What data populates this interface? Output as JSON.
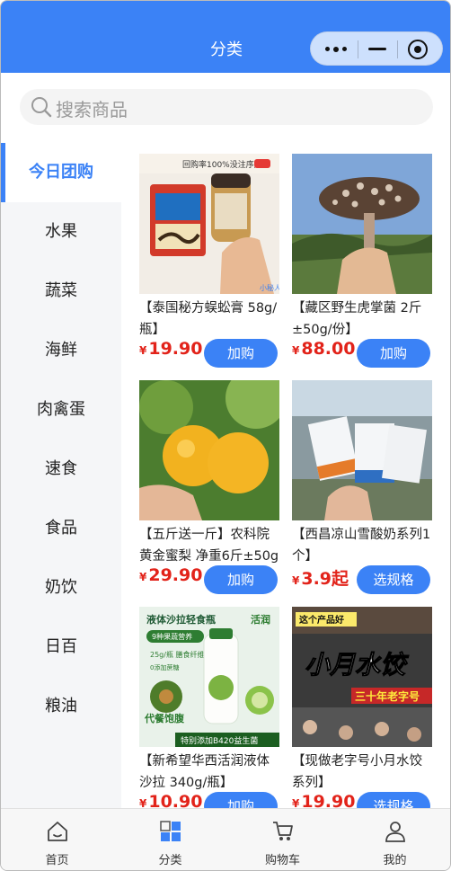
{
  "header": {
    "title": "分类"
  },
  "search": {
    "placeholder": "搜索商品"
  },
  "sidebar": {
    "items": [
      {
        "label": "今日团购",
        "active": true
      },
      {
        "label": "水果"
      },
      {
        "label": "蔬菜"
      },
      {
        "label": "海鲜"
      },
      {
        "label": "肉禽蛋"
      },
      {
        "label": "速食"
      },
      {
        "label": "食品"
      },
      {
        "label": "奶饮"
      },
      {
        "label": "日百"
      },
      {
        "label": "粮油"
      }
    ]
  },
  "products": [
    {
      "name": "【泰国秘方蜈蚣膏 58g/瓶】",
      "currency": "¥",
      "price": "19.90",
      "button": "加购",
      "image_text_top": "回购率100%没注序产",
      "image_text_bottom": "小秘人"
    },
    {
      "name": "【藏区野生虎掌菌 2斤±50g/份】",
      "currency": "¥",
      "price": "88.00",
      "button": "加购"
    },
    {
      "name": "【五斤送一斤】农科院黄金蜜梨 净重6斤±50g",
      "currency": "¥",
      "price": "29.90",
      "button": "加购"
    },
    {
      "name": "【西昌凉山雪酸奶系列1个】",
      "currency": "¥",
      "price": "3.9起",
      "button": "选规格"
    },
    {
      "name": "【新希望华西活润液体沙拉 340g/瓶】",
      "currency": "¥",
      "price": "10.90",
      "button": "加购",
      "image_text_top": "液体沙拉轻食瓶",
      "image_brand": "活润",
      "image_tag1": "9种果蔬营养",
      "image_tag2": "25g/瓶 膳食纤维",
      "image_tag3": "0添加蔗糖",
      "image_text_left": "代餐饱腹",
      "image_text_bottom": "特别添加B420益生菌"
    },
    {
      "name": "【现做老字号小月水饺系列】",
      "currency": "¥",
      "price": "19.90",
      "button": "选规格",
      "image_badge": "这个产品好",
      "image_title": "小月水饺",
      "image_subtitle": "三十年老字号"
    }
  ],
  "tabbar": {
    "items": [
      {
        "label": "首页"
      },
      {
        "label": "分类"
      },
      {
        "label": "购物车"
      },
      {
        "label": "我的"
      }
    ]
  },
  "colors": {
    "primary": "#3b82f6",
    "price": "#e2231a"
  }
}
